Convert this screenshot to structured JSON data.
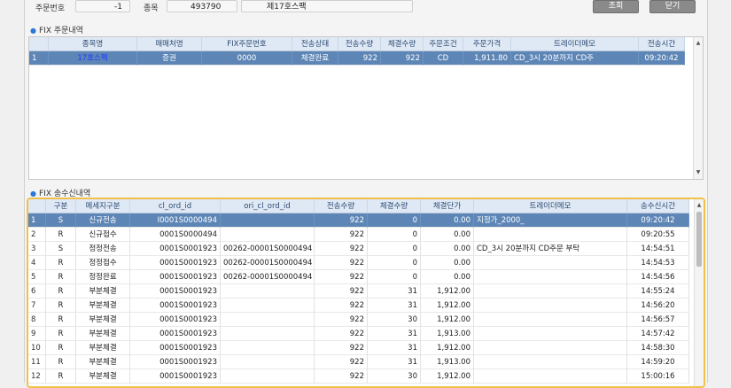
{
  "filter": {
    "order_no_label": "주문번호",
    "order_no_value": "-1",
    "stock_label": "종목",
    "stock_code": "493790",
    "stock_name": "제17호스팩",
    "query_button": "조회",
    "close_button": "닫기"
  },
  "order_section": {
    "title": "FIX 주문내역",
    "columns": [
      "",
      "종목명",
      "매매처명",
      "FIX주문번호",
      "전송상태",
      "전송수량",
      "체결수량",
      "주문조건",
      "주문가격",
      "트레이더메모",
      "전송시간"
    ],
    "rows": [
      [
        "1",
        "17호스팩",
        "증권",
        "0000",
        "체결완료",
        "922",
        "922",
        "CD",
        "1,911.80",
        "CD_3시 20분까지 CD주",
        "09:20:42"
      ]
    ]
  },
  "msg_section": {
    "title": "FIX 송수신내역",
    "columns": [
      "",
      "구분",
      "메세지구분",
      "cl_ord_id",
      "ori_cl_ord_id",
      "전송수량",
      "체결수량",
      "체결단가",
      "트레이더메모",
      "송수신시간"
    ],
    "rows": [
      [
        "1",
        "S",
        "신규전송",
        "I0001S0000494",
        "",
        "922",
        "0",
        "0.00",
        "지정가_2000_",
        "09:20:42"
      ],
      [
        "2",
        "R",
        "신규접수",
        "0001S0000494",
        "",
        "922",
        "0",
        "0.00",
        "",
        "09:20:55"
      ],
      [
        "3",
        "S",
        "정정전송",
        "0001S0001923",
        "00262-00001S0000494",
        "922",
        "0",
        "0.00",
        "CD_3시 20분까지 CD주문 부탁",
        "14:54:51"
      ],
      [
        "4",
        "R",
        "정정접수",
        "0001S0001923",
        "00262-00001S0000494",
        "922",
        "0",
        "0.00",
        "",
        "14:54:53"
      ],
      [
        "5",
        "R",
        "정정완료",
        "0001S0001923",
        "00262-00001S0000494",
        "922",
        "0",
        "0.00",
        "",
        "14:54:56"
      ],
      [
        "6",
        "R",
        "부분체결",
        "0001S0001923",
        "",
        "922",
        "31",
        "1,912.00",
        "",
        "14:55:24"
      ],
      [
        "7",
        "R",
        "부분체결",
        "0001S0001923",
        "",
        "922",
        "31",
        "1,912.00",
        "",
        "14:56:20"
      ],
      [
        "8",
        "R",
        "부분체결",
        "0001S0001923",
        "",
        "922",
        "30",
        "1,912.00",
        "",
        "14:56:57"
      ],
      [
        "9",
        "R",
        "부분체결",
        "0001S0001923",
        "",
        "922",
        "31",
        "1,913.00",
        "",
        "14:57:42"
      ],
      [
        "10",
        "R",
        "부분체결",
        "0001S0001923",
        "",
        "922",
        "31",
        "1,912.00",
        "",
        "14:58:30"
      ],
      [
        "11",
        "R",
        "부분체결",
        "0001S0001923",
        "",
        "922",
        "31",
        "1,913.00",
        "",
        "14:59:20"
      ],
      [
        "12",
        "R",
        "부분체결",
        "0001S0001923",
        "",
        "922",
        "30",
        "1,912.00",
        "",
        "15:00:16"
      ]
    ]
  }
}
